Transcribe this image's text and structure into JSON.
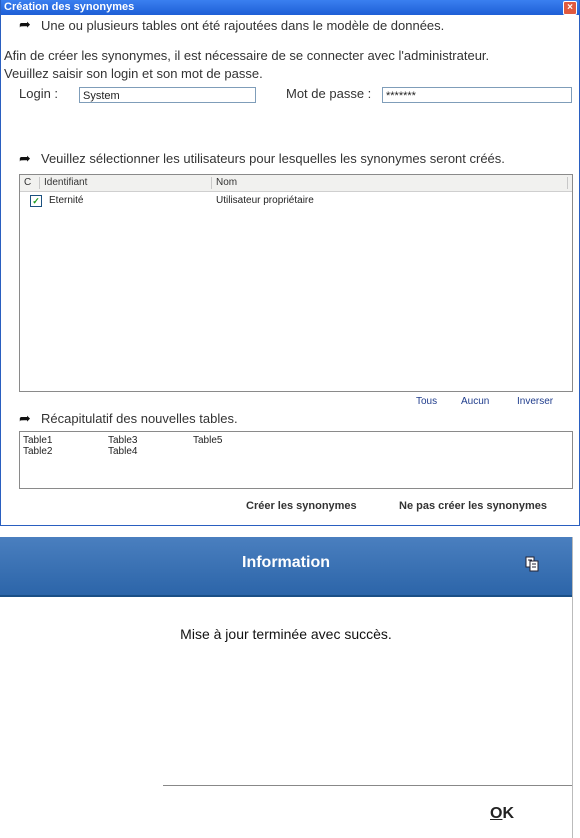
{
  "dialog1": {
    "title": "Création des synonymes",
    "info_line": "Une ou plusieurs tables ont été rajoutées dans le modèle de données.",
    "instructions_line1": "Afin de créer les synonymes, il est nécessaire de se connecter avec l'administrateur.",
    "instructions_line2": "Veuillez saisir son login et son mot de passe.",
    "login_label": "Login :",
    "login_value": "System",
    "password_label": "Mot de passe :",
    "password_value": "*******",
    "select_users_label": "Veuillez sélectionner les utilisateurs pour lesquelles les synonymes seront créés.",
    "list": {
      "columns": [
        "C",
        "Identifiant",
        "Nom"
      ],
      "rows": [
        {
          "checked": true,
          "identifiant": "Eternité",
          "nom": "Utilisateur propriétaire"
        }
      ]
    },
    "tous_label": "Tous",
    "aucun_label": "Aucun",
    "inverser_label": "Inverser",
    "summary_label": "Récapitulatif des nouvelles tables.",
    "tables": [
      "Table1",
      "Table2",
      "Table3",
      "Table4",
      "Table5"
    ],
    "create_button": "Créer les synonymes",
    "no_create_button": "Ne pas créer les synonymes"
  },
  "dialog2": {
    "title": "Information",
    "message": "Mise à jour terminée avec succès.",
    "ok_accel": "O",
    "ok_rest": "K"
  }
}
